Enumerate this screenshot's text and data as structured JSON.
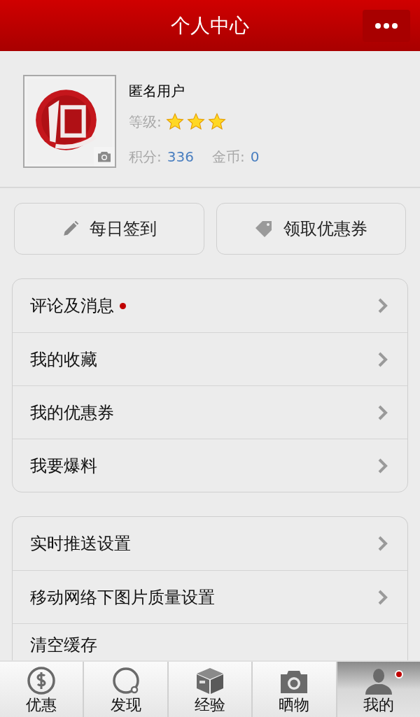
{
  "header": {
    "title": "个人中心"
  },
  "profile": {
    "name": "匿名用户",
    "level_label": "等级:",
    "stars": 3,
    "points_label": "积分:",
    "points": "336",
    "coins_label": "金币:",
    "coins": "0"
  },
  "actions": [
    {
      "label": "每日签到",
      "kind": "pencil"
    },
    {
      "label": "领取优惠券",
      "kind": "tag"
    }
  ],
  "menu_groups": [
    [
      {
        "label": "评论及消息",
        "unread": true,
        "chevron": true
      },
      {
        "label": "我的收藏",
        "unread": false,
        "chevron": true
      },
      {
        "label": "我的优惠券",
        "unread": false,
        "chevron": true
      },
      {
        "label": "我要爆料",
        "unread": false,
        "chevron": true
      }
    ],
    [
      {
        "label": "实时推送设置",
        "unread": false,
        "chevron": true
      },
      {
        "label": "移动网络下图片质量设置",
        "unread": false,
        "chevron": true
      },
      {
        "label": "清空缓存",
        "unread": false,
        "chevron": false
      }
    ]
  ],
  "tabs": [
    {
      "label": "优惠",
      "kind": "dollar",
      "selected": false,
      "unread": false
    },
    {
      "label": "发现",
      "kind": "ring",
      "selected": false,
      "unread": false
    },
    {
      "label": "经验",
      "kind": "box",
      "selected": false,
      "unread": false
    },
    {
      "label": "晒物",
      "kind": "camera",
      "selected": false,
      "unread": false
    },
    {
      "label": "我的",
      "kind": "person",
      "selected": true,
      "unread": true
    }
  ]
}
